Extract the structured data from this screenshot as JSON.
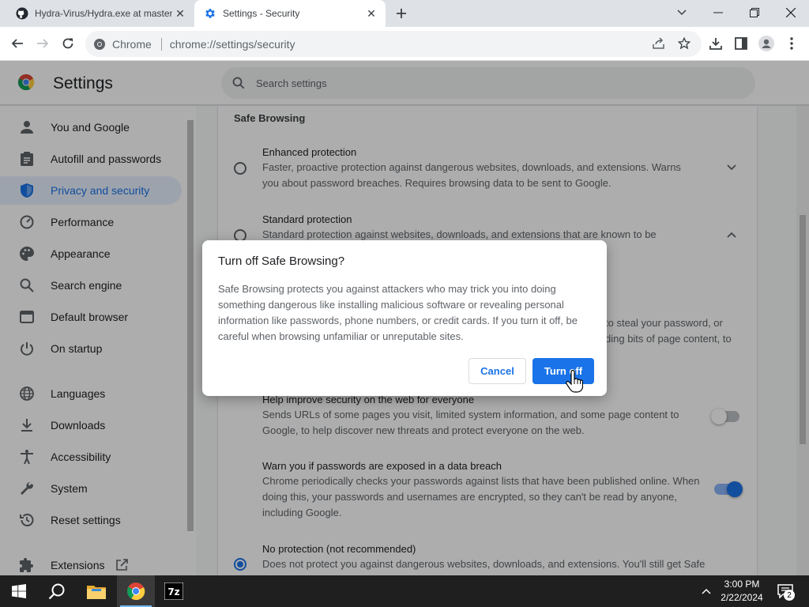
{
  "browser": {
    "tabs": [
      {
        "title": "Hydra-Virus/Hydra.exe at master",
        "active": false
      },
      {
        "title": "Settings - Security",
        "active": true
      }
    ],
    "omnibox": {
      "chip_label": "Chrome",
      "url": "chrome://settings/security"
    }
  },
  "settings": {
    "header_title": "Settings",
    "search_placeholder": "Search settings"
  },
  "sidebar": {
    "items": [
      {
        "label": "You and Google",
        "icon": "person-icon"
      },
      {
        "label": "Autofill and passwords",
        "icon": "clipboard-icon"
      },
      {
        "label": "Privacy and security",
        "icon": "shield-icon",
        "active": true
      },
      {
        "label": "Performance",
        "icon": "speedometer-icon"
      },
      {
        "label": "Appearance",
        "icon": "palette-icon"
      },
      {
        "label": "Search engine",
        "icon": "search-icon"
      },
      {
        "label": "Default browser",
        "icon": "browser-icon"
      },
      {
        "label": "On startup",
        "icon": "power-icon"
      },
      {
        "label": "Languages",
        "icon": "globe-icon"
      },
      {
        "label": "Downloads",
        "icon": "download-icon"
      },
      {
        "label": "Accessibility",
        "icon": "accessibility-icon"
      },
      {
        "label": "System",
        "icon": "wrench-icon"
      },
      {
        "label": "Reset settings",
        "icon": "history-icon"
      },
      {
        "label": "Extensions",
        "icon": "puzzle-icon"
      }
    ]
  },
  "main": {
    "section_title": "Safe Browsing",
    "enhanced": {
      "title": "Enhanced protection",
      "desc1": "Faster, proactive protection against dangerous websites, downloads, and extensions. Warns",
      "desc2": "you about password breaches. Requires browsing data to be sent to Google."
    },
    "standard": {
      "title": "Standard protection",
      "desc1": "Standard protection against websites, downloads, and extensions that are known to be"
    },
    "partial1": "to steal your password, or",
    "partial2": "ding bits of page content, to",
    "help_improve": {
      "title": "Help improve security on the web for everyone",
      "desc1": "Sends URLs of some pages you visit, limited system information, and some page content to",
      "desc2": "Google, to help discover new threats and protect everyone on the web."
    },
    "password_warn": {
      "title": "Warn you if passwords are exposed in a data breach",
      "desc1": "Chrome periodically checks your passwords against lists that have been published online. When",
      "desc2": "doing this, your passwords and usernames are encrypted, so they can't be read by anyone,",
      "desc3": "including Google."
    },
    "no_protection": {
      "title": "No protection (not recommended)",
      "desc1": "Does not protect you against dangerous websites, downloads, and extensions. You'll still get Safe"
    }
  },
  "dialog": {
    "title": "Turn off Safe Browsing?",
    "body": "Safe Browsing protects you against attackers who may trick you into doing something dangerous like installing malicious software or revealing personal information like passwords, phone numbers, or credit cards. If you turn it off, be careful when browsing unfamiliar or unreputable sites.",
    "cancel_label": "Cancel",
    "confirm_label": "Turn off"
  },
  "taskbar": {
    "time": "3:00 PM",
    "date": "2/22/2024",
    "notification_count": "2",
    "apps": [
      "start-icon",
      "search-icon",
      "file-explorer-icon",
      "chrome-icon",
      "7zip-icon"
    ]
  },
  "colors": {
    "accent": "#1a73e8",
    "active_nav_bg": "#e8f0fe",
    "taskbar": "#1f1f1f"
  }
}
